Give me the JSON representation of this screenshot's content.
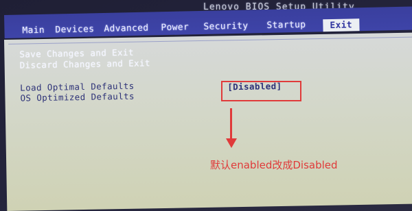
{
  "title": "Lenovo BIOS Setup Utility",
  "menu": [
    {
      "label": "Main"
    },
    {
      "label": "Devices"
    },
    {
      "label": "Advanced"
    },
    {
      "label": "Power"
    },
    {
      "label": "Security"
    },
    {
      "label": "Startup"
    },
    {
      "label": "Exit"
    }
  ],
  "selected_menu": "Exit",
  "options": [
    {
      "label": "Save Changes and Exit"
    },
    {
      "label": "Discard Changes and Exit"
    },
    {
      "label": "Load Optimal Defaults"
    },
    {
      "label": "OS Optimized Defaults",
      "value": "[Disabled]"
    }
  ],
  "annotation": {
    "text": "默认enabled改成Disabled",
    "color": "#e03a3a"
  },
  "colors": {
    "menubar": "#3e44a8",
    "panel": "#d3d7c8",
    "selected_text": "#3035a0"
  }
}
